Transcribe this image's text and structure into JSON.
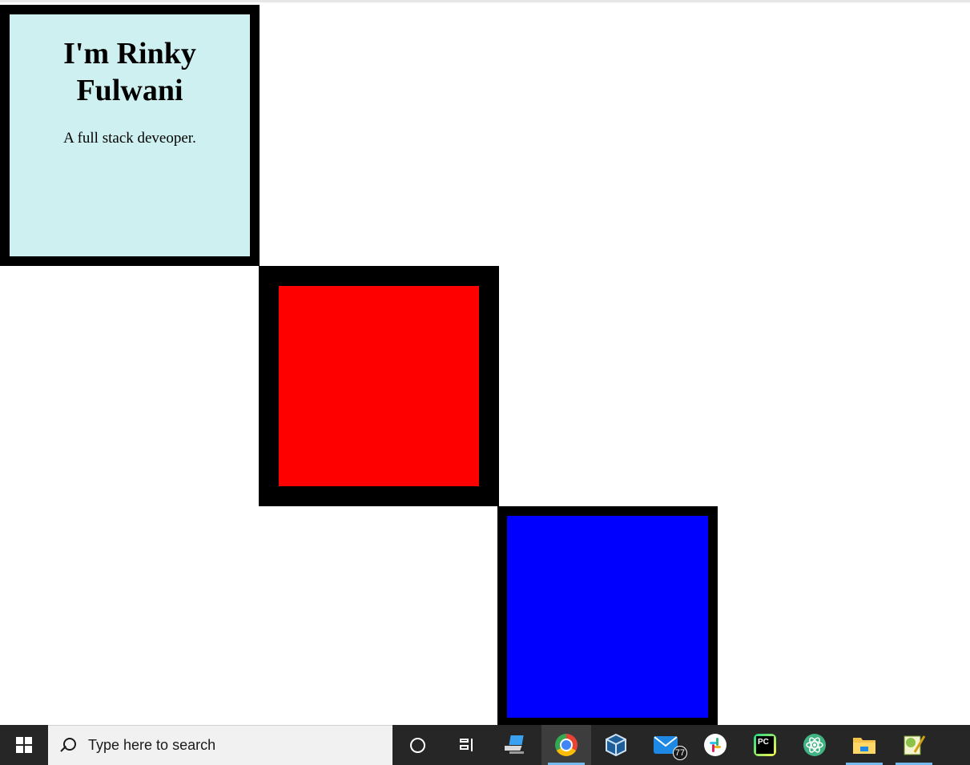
{
  "page": {
    "heading": "I'm Rinky Fulwani",
    "tagline": "A full stack deveoper.",
    "colors": {
      "profile_bg": "#cef0f1",
      "border": "#000000",
      "red_box": "#ff0000",
      "blue_box": "#0000ff"
    }
  },
  "taskbar": {
    "start_icon": "windows-start-icon",
    "search_placeholder": "Type here to search",
    "items": [
      {
        "name": "cortana",
        "icon": "cortana-icon"
      },
      {
        "name": "task-view",
        "icon": "task-view-icon"
      },
      {
        "name": "vmware-horizon",
        "icon": "remote-desktop-icon"
      },
      {
        "name": "chrome",
        "icon": "chrome-icon",
        "active": true
      },
      {
        "name": "virtualbox",
        "icon": "virtualbox-icon"
      },
      {
        "name": "mail",
        "icon": "mail-icon",
        "badge": "77"
      },
      {
        "name": "slack",
        "icon": "slack-icon"
      },
      {
        "name": "pycharm",
        "icon": "pycharm-icon",
        "label": "PC"
      },
      {
        "name": "atom",
        "icon": "atom-icon"
      },
      {
        "name": "file-explorer",
        "icon": "folder-icon"
      },
      {
        "name": "notepad-plus-plus",
        "icon": "notepad-icon"
      }
    ]
  }
}
